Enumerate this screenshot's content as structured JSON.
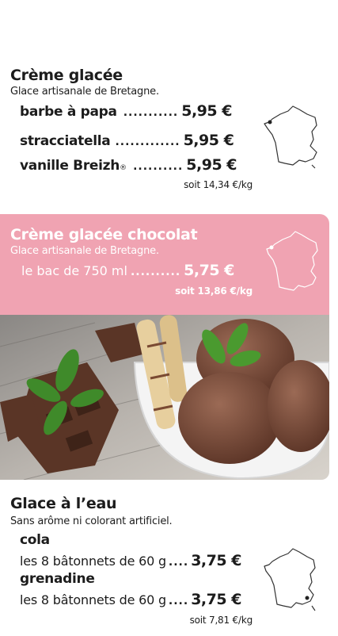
{
  "section1": {
    "title": "Crème glacée",
    "subtitle": "Glace artisanale de Bretagne.",
    "items": [
      {
        "name": "barbe à papa",
        "dots": "...........",
        "price": "5,95 €"
      },
      {
        "name": "stracciatella",
        "dots": ".............",
        "price": "5,95 €"
      },
      {
        "name": "vanille Breizh",
        "sup": "®",
        "dots": "..........",
        "price": "5,95 €"
      }
    ],
    "per_kg": "soit 14,34 €/kg"
  },
  "section2": {
    "title": "Crème glacée chocolat",
    "subtitle": "Glace artisanale de Bretagne.",
    "item": {
      "name": "le bac de 750 ml",
      "dots": "..........",
      "price": "5,75 €"
    },
    "per_kg": "soit 13,86 €/kg",
    "band_color": "#f0a3b2"
  },
  "section3": {
    "title": "Glace à l’eau",
    "subtitle": "Sans arôme ni colorant artificiel.",
    "items": [
      {
        "name": "cola",
        "pack": "les 8 bâtonnets de 60 g",
        "dots": "....",
        "price": "3,75 €"
      },
      {
        "name": "grenadine",
        "pack": "les 8 bâtonnets de 60 g",
        "dots": "....",
        "price": "3,75 €"
      }
    ],
    "per_kg": "soit 7,81 €/kg"
  },
  "icons": {
    "map": "france-map-icon",
    "photo": "chocolate-ice-cream-photo"
  }
}
